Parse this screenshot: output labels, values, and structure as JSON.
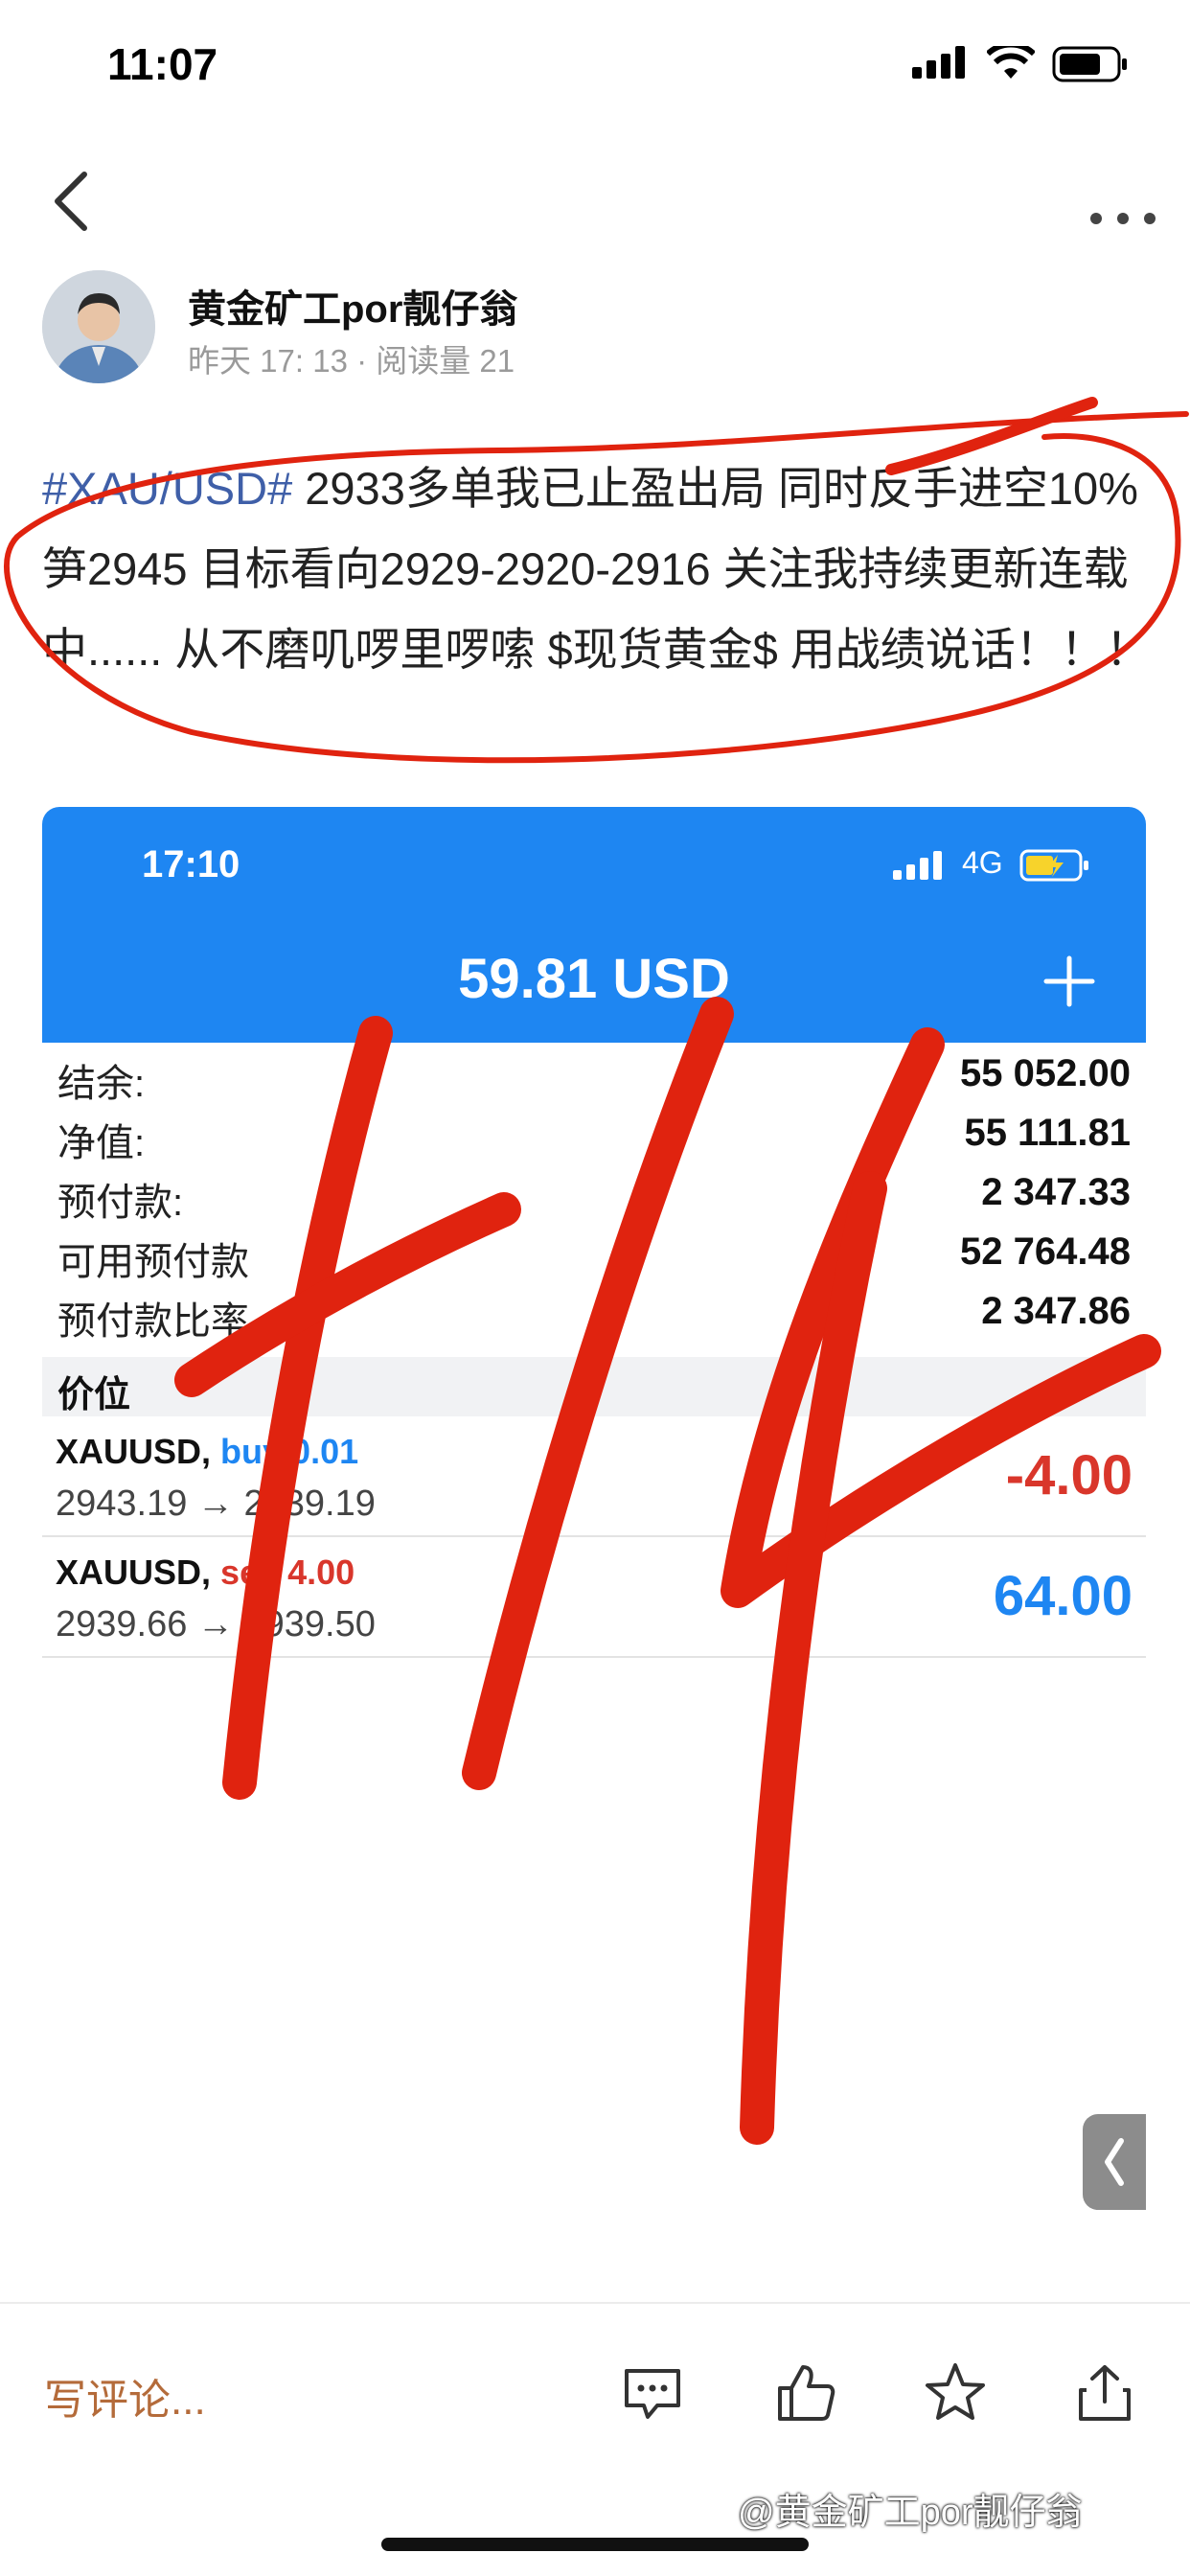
{
  "status_bar": {
    "time": "11:07"
  },
  "author": {
    "name": "黄金矿工por靓仔翁",
    "meta": "昨天 17: 13 · 阅读量 21"
  },
  "post": {
    "hashtag": "#XAU/USD#",
    "body": " 2933多单我已止盈出局 同时反手进空10% 笋2945 目标看向2929-2920-2916 关注我持续更新连载中...... 从不磨叽啰里啰嗦 $现货黄金$ 用战绩说话！！！"
  },
  "embed": {
    "time": "17:10",
    "network": "4G",
    "balance_header": "59.81 USD",
    "account_rows": [
      {
        "label": "结余:",
        "value": "55 052.00"
      },
      {
        "label": "净值:",
        "value": "55 111.81"
      },
      {
        "label": "预付款:",
        "value": "2 347.33"
      },
      {
        "label": "可用预付款",
        "value": "52 764.48"
      },
      {
        "label": "预付款比率",
        "value": "2 347.86"
      }
    ],
    "section_title": "价位",
    "trades": [
      {
        "symbol": "XAUUSD,",
        "side": "buy 0.01",
        "prices": "2943.19 → 2939.19",
        "profit": "-4.00"
      },
      {
        "symbol": "XAUUSD,",
        "side": "sell 4.00",
        "prices": "2939.66 → 2939.50",
        "profit": "64.00"
      }
    ]
  },
  "bottom_bar": {
    "comment_placeholder": "写评论..."
  },
  "watermark": "@黄金矿工por靓仔翁",
  "colors": {
    "embed_header": "#1e86f2",
    "ink": "#e0230f",
    "hashtag": "#3f5fa8",
    "loss": "#d9362b"
  }
}
